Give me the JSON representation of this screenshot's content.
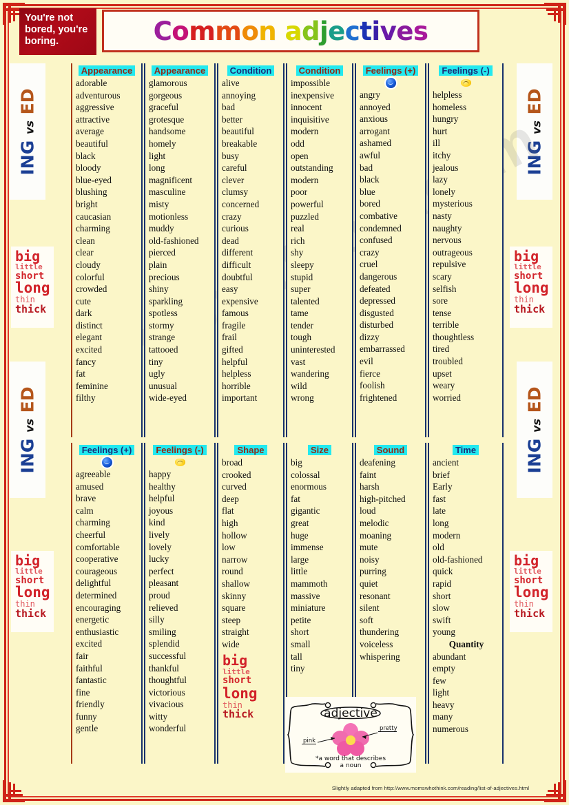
{
  "page": {
    "background_color": "#fbf6c8",
    "frame_color": "#cf2418"
  },
  "header": {
    "quote": "You're not bored, you're boring.",
    "title": "Common adjectives",
    "title_letters": [
      {
        "ch": "C",
        "color": "#9c1f9c"
      },
      {
        "ch": "o",
        "color": "#c41277"
      },
      {
        "ch": "m",
        "color": "#d62020"
      },
      {
        "ch": "m",
        "color": "#e34a14"
      },
      {
        "ch": "o",
        "color": "#ef8b07"
      },
      {
        "ch": "n",
        "color": "#f0b400"
      },
      {
        "ch": " ",
        "color": "#000000"
      },
      {
        "ch": "a",
        "color": "#d8d800"
      },
      {
        "ch": "d",
        "color": "#86c41a"
      },
      {
        "ch": "j",
        "color": "#2f9e2f"
      },
      {
        "ch": "e",
        "color": "#1a9e8a"
      },
      {
        "ch": "c",
        "color": "#1f6fd0"
      },
      {
        "ch": "t",
        "color": "#1c32b4"
      },
      {
        "ch": "i",
        "color": "#3a1fa8"
      },
      {
        "ch": "v",
        "color": "#6a1aa8"
      },
      {
        "ch": "e",
        "color": "#8a1a9e"
      },
      {
        "ch": "s",
        "color": "#a8199c"
      }
    ]
  },
  "side_panels": {
    "ing_vs_ed": {
      "ing": "ING",
      "vs": "vs",
      "ed": "ED"
    },
    "size_words": [
      "big",
      "little",
      "short",
      "long",
      "thin",
      "thick"
    ]
  },
  "watermark": "eslprintable.com",
  "top_row": [
    {
      "header": "Appearance",
      "header_color": "#8d2c1a",
      "emoji": null,
      "words": [
        "adorable",
        "adventurous",
        "aggressive",
        "attractive",
        "average",
        "beautiful",
        "black",
        "bloody",
        "blue-eyed",
        "blushing",
        "bright",
        "caucasian",
        "charming",
        "clean",
        "clear",
        "cloudy",
        "colorful",
        "crowded",
        "cute",
        "dark",
        "distinct",
        "elegant",
        "excited",
        "fancy",
        "fat",
        "feminine",
        "filthy"
      ]
    },
    {
      "header": "Appearance",
      "header_color": "#8d2c1a",
      "emoji": null,
      "words": [
        "glamorous",
        "gorgeous",
        "graceful",
        "grotesque",
        "handsome",
        "homely",
        "light",
        "long",
        "magnificent",
        "masculine",
        "misty",
        "motionless",
        "muddy",
        "old-fashioned",
        "pierced",
        "plain",
        "precious",
        "shiny",
        "sparkling",
        "spotless",
        "stormy",
        "strange",
        "tattooed",
        "tiny",
        "ugly",
        "unusual",
        "wide-eyed"
      ]
    },
    {
      "header": "Condition",
      "header_color": "#1a2f7a",
      "emoji": null,
      "words": [
        "alive",
        "annoying",
        "bad",
        "better",
        "beautiful",
        "breakable",
        "busy",
        "careful",
        "clever",
        "clumsy",
        "concerned",
        "crazy",
        "curious",
        "dead",
        "different",
        "difficult",
        "doubtful",
        "easy",
        "expensive",
        "famous",
        "fragile",
        "frail",
        "gifted",
        "helpful",
        "helpless",
        "horrible",
        "important"
      ]
    },
    {
      "header": "Condition",
      "header_color": "#8d2c1a",
      "emoji": null,
      "words": [
        "impossible",
        "inexpensive",
        "innocent",
        "inquisitive",
        "modern",
        "odd",
        "open",
        "outstanding",
        "modern",
        "poor",
        "powerful",
        "puzzled",
        "real",
        "rich",
        "shy",
        "sleepy",
        "stupid",
        "super",
        "talented",
        "tame",
        "tender",
        "tough",
        "uninterested",
        "vast",
        "wandering",
        "wild",
        "wrong"
      ]
    },
    {
      "header": "Feelings (+)",
      "header_color": "#8d2c1a",
      "emoji": "blue-sad-face",
      "words": [
        "angry",
        "annoyed",
        "anxious",
        "arrogant",
        "ashamed",
        "awful",
        "bad",
        "black",
        "blue",
        "bored",
        "combative",
        "condemned",
        "confused",
        "crazy",
        "cruel",
        "dangerous",
        "defeated",
        "depressed",
        "disgusted",
        "disturbed",
        "dizzy",
        "embarrassed",
        "evil",
        "fierce",
        "foolish",
        "frightened"
      ]
    },
    {
      "header": "Feelings (-)",
      "header_color": "#1a2f7a",
      "emoji": "yellow-smile-face",
      "words": [
        "helpless",
        "homeless",
        "hungry",
        "hurt",
        "ill",
        "itchy",
        "jealous",
        "lazy",
        "lonely",
        "mysterious",
        "nasty",
        "naughty",
        "nervous",
        "outrageous",
        "repulsive",
        "scary",
        "selfish",
        "sore",
        "tense",
        "terrible",
        "thoughtless",
        "tired",
        "troubled",
        "upset",
        "weary",
        "worried"
      ]
    }
  ],
  "bottom_row": [
    {
      "header": "Feelings (+)",
      "header_color": "#1a2f7a",
      "emoji": "blue-sad-face",
      "words": [
        "agreeable",
        "amused",
        "brave",
        "calm",
        "charming",
        "cheerful",
        "comfortable",
        "cooperative",
        "courageous",
        "delightful",
        "determined",
        "encouraging",
        "energetic",
        "enthusiastic",
        "excited",
        "fair",
        "faithful",
        "fantastic",
        "fine",
        "friendly",
        "funny",
        "gentle"
      ]
    },
    {
      "header": "Feelings (-)",
      "header_color": "#8d2c1a",
      "emoji": "yellow-smile-face",
      "words": [
        "happy",
        "healthy",
        "helpful",
        "joyous",
        "kind",
        "lively",
        "lovely",
        "lucky",
        "perfect",
        "pleasant",
        "proud",
        "relieved",
        "silly",
        "smiling",
        "splendid",
        "successful",
        "thankful",
        "thoughtful",
        "victorious",
        "vivacious",
        "witty",
        "wonderful"
      ]
    },
    {
      "header": "Shape",
      "header_color": "#8d2c1a",
      "emoji": null,
      "words": [
        "broad",
        "crooked",
        "curved",
        "deep",
        "flat",
        "high",
        "hollow",
        "low",
        "narrow",
        "round",
        "shallow",
        "skinny",
        "square",
        "steep",
        "straight",
        "wide"
      ],
      "trailing_size_words": [
        "big",
        "little",
        "short",
        "long",
        "thin",
        "thick"
      ]
    },
    {
      "header": "Size",
      "header_color": "#8d2c1a",
      "emoji": null,
      "words": [
        "big",
        "colossal",
        "enormous",
        "fat",
        "gigantic",
        "great",
        "huge",
        "immense",
        "large",
        "little",
        "mammoth",
        "massive",
        "miniature",
        "petite",
        "short",
        "small",
        "tall",
        "tiny"
      ]
    },
    {
      "header": "Sound",
      "header_color": "#8d2c1a",
      "emoji": null,
      "words": [
        "deafening",
        "faint",
        "harsh",
        "high-pitched",
        "loud",
        "melodic",
        "moaning",
        "mute",
        "noisy",
        "purring",
        "quiet",
        "resonant",
        "silent",
        "soft",
        "thundering",
        "voiceless",
        "whispering"
      ]
    },
    {
      "header": "Time",
      "header_color": "#1a2f7a",
      "emoji": null,
      "words": [
        "ancient",
        "brief",
        "Early",
        "fast",
        "late",
        "long",
        "modern",
        "old",
        "old-fashioned",
        "quick",
        "rapid",
        "short",
        "slow",
        "swift",
        "young"
      ],
      "sub_header": "Quantity",
      "sub_words": [
        "abundant",
        "empty",
        "few",
        "light",
        "heavy",
        "many",
        "numerous"
      ]
    }
  ],
  "adjective_diagram": {
    "title": "adjective",
    "label_left": "pink",
    "label_right": "pretty",
    "definition_line1": "*a word that describes",
    "definition_line2": "a noun"
  },
  "footer": {
    "credit": "Slightly adapted from http://www.momswhothink.com/reading/list-of-adjectives.html"
  }
}
